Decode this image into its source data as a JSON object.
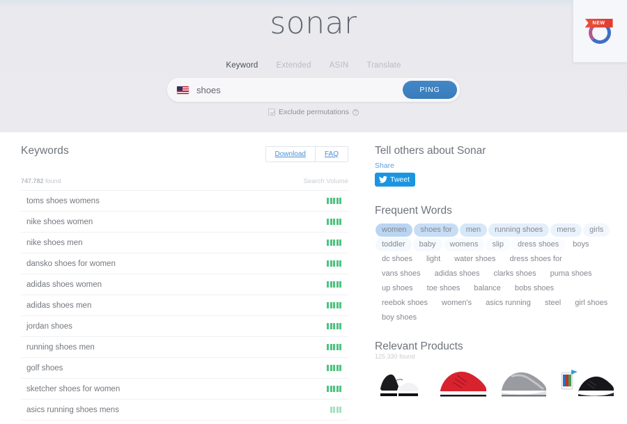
{
  "header": {
    "logo": "sonar",
    "tabs": [
      {
        "label": "Keyword",
        "active": true
      },
      {
        "label": "Extended",
        "active": false
      },
      {
        "label": "ASIN",
        "active": false
      },
      {
        "label": "Translate",
        "active": false
      }
    ],
    "search": {
      "value": "shoes",
      "placeholder": "shoes",
      "marketplace_flag": "us-flag-icon",
      "submit_label": "PING"
    },
    "exclude_permutations": {
      "label": "Exclude permutations",
      "checked": true,
      "help_icon": "question-mark-icon"
    },
    "new_badge": {
      "ribbon_label": "NEW",
      "logo_icon": "sonar-circle-logo-icon"
    },
    "colors": {
      "background_top": "#dde5ed",
      "background": "#eaeaef",
      "logo_text": "#5f6671",
      "ping_button": "#3f80c2"
    }
  },
  "keywords_panel": {
    "title": "Keywords",
    "download_label": "Download",
    "faq_label": "FAQ",
    "found_count": "747.782",
    "found_suffix": "found",
    "volume_header": "Search Volume",
    "rows": [
      {
        "keyword": "toms shoes womens",
        "volume": 5,
        "faded": false
      },
      {
        "keyword": "nike shoes women",
        "volume": 5,
        "faded": false
      },
      {
        "keyword": "nike shoes men",
        "volume": 5,
        "faded": false
      },
      {
        "keyword": "dansko shoes for women",
        "volume": 5,
        "faded": false
      },
      {
        "keyword": "adidas shoes women",
        "volume": 5,
        "faded": false
      },
      {
        "keyword": "adidas shoes men",
        "volume": 5,
        "faded": false
      },
      {
        "keyword": "jordan shoes",
        "volume": 5,
        "faded": false
      },
      {
        "keyword": "running shoes men",
        "volume": 5,
        "faded": false
      },
      {
        "keyword": "golf shoes",
        "volume": 5,
        "faded": false
      },
      {
        "keyword": "sketcher shoes for women",
        "volume": 5,
        "faded": false
      },
      {
        "keyword": "asics running shoes mens",
        "volume": 4,
        "faded": true
      }
    ],
    "bar_color": "#4cc47f",
    "bar_color_faded": "#a7dfc0"
  },
  "share_panel": {
    "title": "Tell others about Sonar",
    "share_label": "Share",
    "tweet_label": "Tweet",
    "tweet_icon": "twitter-bird-icon",
    "tweet_color": "#1b95e0"
  },
  "frequent_words": {
    "title": "Frequent Words",
    "tags": [
      {
        "label": "women",
        "bg": "#b9d5f2"
      },
      {
        "label": "shoes for",
        "bg": "#c6ddf5"
      },
      {
        "label": "men",
        "bg": "#d5e7f8"
      },
      {
        "label": "running shoes",
        "bg": "#e3eefb"
      },
      {
        "label": "mens",
        "bg": "#eaf3fc"
      },
      {
        "label": "girls",
        "bg": "#f2f7fd"
      },
      {
        "label": "toddler",
        "bg": "#f4f9fd"
      },
      {
        "label": "baby",
        "bg": "#f6fafe"
      },
      {
        "label": "womens",
        "bg": "#f8fbfe"
      },
      {
        "label": "slip",
        "bg": "#f9fcfe"
      },
      {
        "label": "dress shoes",
        "bg": "#fafcff"
      },
      {
        "label": "boys",
        "bg": "#ffffff"
      },
      {
        "label": "dc shoes",
        "bg": "#ffffff"
      },
      {
        "label": "light",
        "bg": "#ffffff"
      },
      {
        "label": "water shoes",
        "bg": "#ffffff"
      },
      {
        "label": "dress shoes for",
        "bg": "#ffffff"
      },
      {
        "label": "vans shoes",
        "bg": "#ffffff"
      },
      {
        "label": "adidas shoes",
        "bg": "#ffffff"
      },
      {
        "label": "clarks shoes",
        "bg": "#ffffff"
      },
      {
        "label": "puma shoes",
        "bg": "#ffffff"
      },
      {
        "label": "up shoes",
        "bg": "#ffffff"
      },
      {
        "label": "toe shoes",
        "bg": "#ffffff"
      },
      {
        "label": "balance",
        "bg": "#ffffff"
      },
      {
        "label": "bobs shoes",
        "bg": "#ffffff"
      },
      {
        "label": "reebok shoes",
        "bg": "#ffffff"
      },
      {
        "label": "women's",
        "bg": "#ffffff"
      },
      {
        "label": "asics running",
        "bg": "#ffffff"
      },
      {
        "label": "steel",
        "bg": "#ffffff"
      },
      {
        "label": "girl shoes",
        "bg": "#ffffff"
      },
      {
        "label": "boy shoes",
        "bg": "#ffffff"
      }
    ]
  },
  "relevant_products": {
    "title": "Relevant Products",
    "found_count": "125.330",
    "found_suffix": "found",
    "items": [
      {
        "alt": "black and white sneakers",
        "icon": "product-thumb-1"
      },
      {
        "alt": "red running shoe",
        "icon": "product-thumb-2"
      },
      {
        "alt": "grey slip-on shoe",
        "icon": "product-thumb-3"
      },
      {
        "alt": "black shoe with phone",
        "icon": "product-thumb-4"
      }
    ]
  }
}
